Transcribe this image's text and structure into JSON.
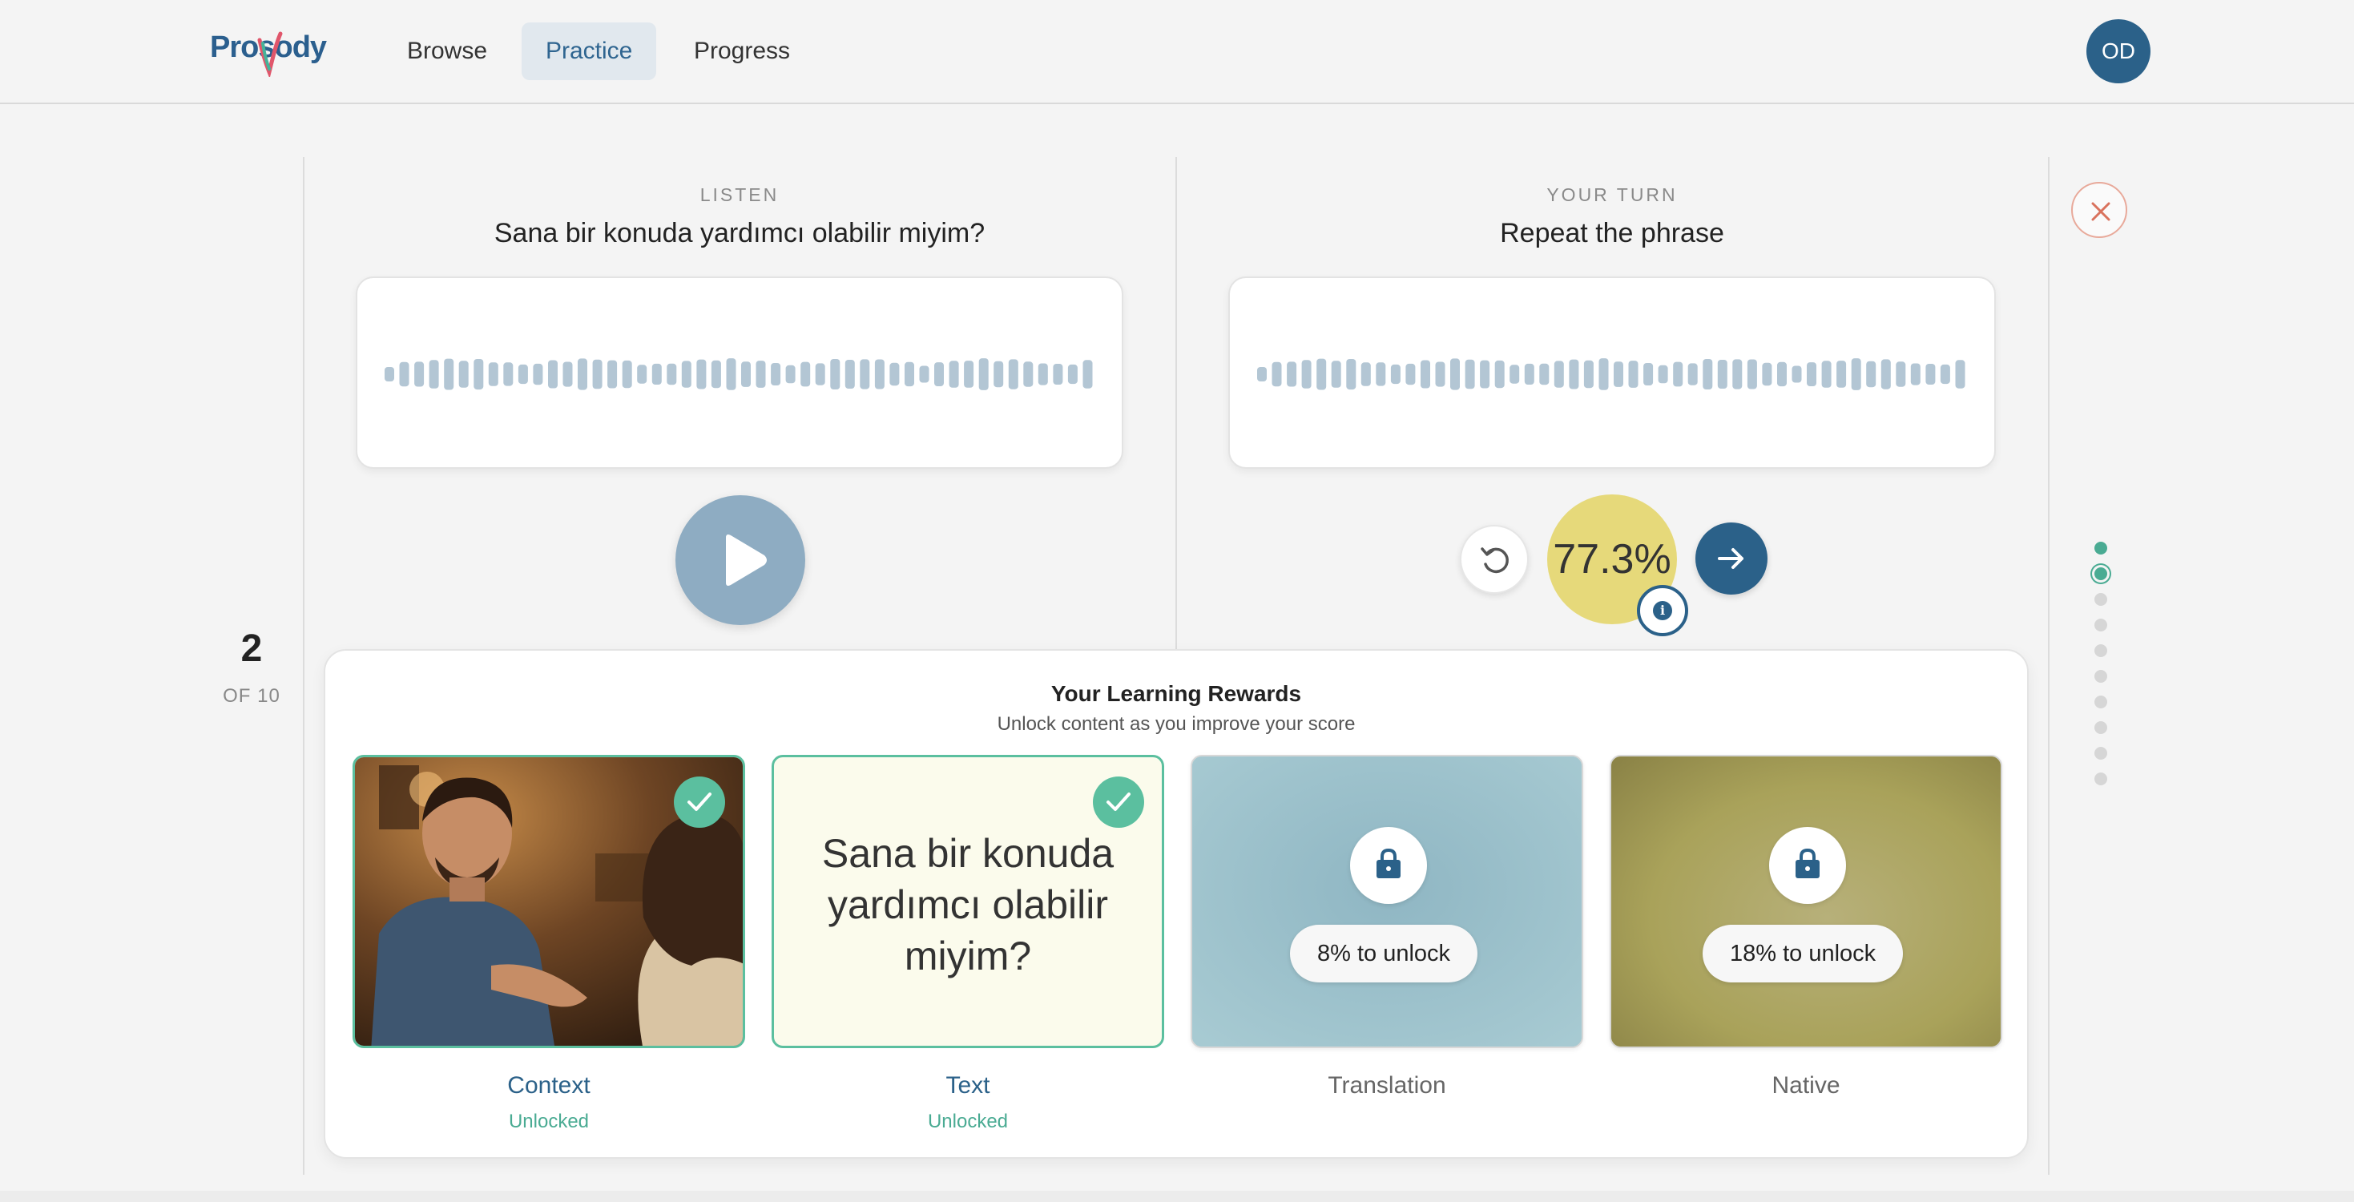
{
  "nav": {
    "logo": "Prosody",
    "items": [
      {
        "label": "Browse",
        "active": false
      },
      {
        "label": "Practice",
        "active": true
      },
      {
        "label": "Progress",
        "active": false
      }
    ],
    "avatar_initials": "OD"
  },
  "counter": {
    "current": "2",
    "total_label": "OF 10"
  },
  "listen": {
    "eyebrow": "LISTEN",
    "phrase": "Sana bir konuda yardımcı olabilir miyim?"
  },
  "your_turn": {
    "eyebrow": "YOUR TURN",
    "phrase": "Repeat the phrase",
    "score": "77.3%"
  },
  "progress": {
    "total": 10,
    "completed": 1,
    "current_index": 1
  },
  "rewards": {
    "title": "Your Learning Rewards",
    "subtitle": "Unlock content as you improve your score",
    "tiles": [
      {
        "label": "Context",
        "status": "Unlocked",
        "unlocked": true
      },
      {
        "label": "Text",
        "status": "Unlocked",
        "unlocked": true,
        "phrase": "Sana bir konuda yardımcı olabilir miyim?"
      },
      {
        "label": "Translation",
        "unlocked": false,
        "unlock_text": "8% to unlock"
      },
      {
        "label": "Native",
        "unlocked": false,
        "unlock_text": "18% to unlock"
      }
    ]
  },
  "colors": {
    "brand": "#2b6189",
    "accent_green": "#5bbf9f",
    "score_yellow": "#e6d97a",
    "translation_tile": "#9dc2cc",
    "native_tile": "#a9a25a"
  }
}
